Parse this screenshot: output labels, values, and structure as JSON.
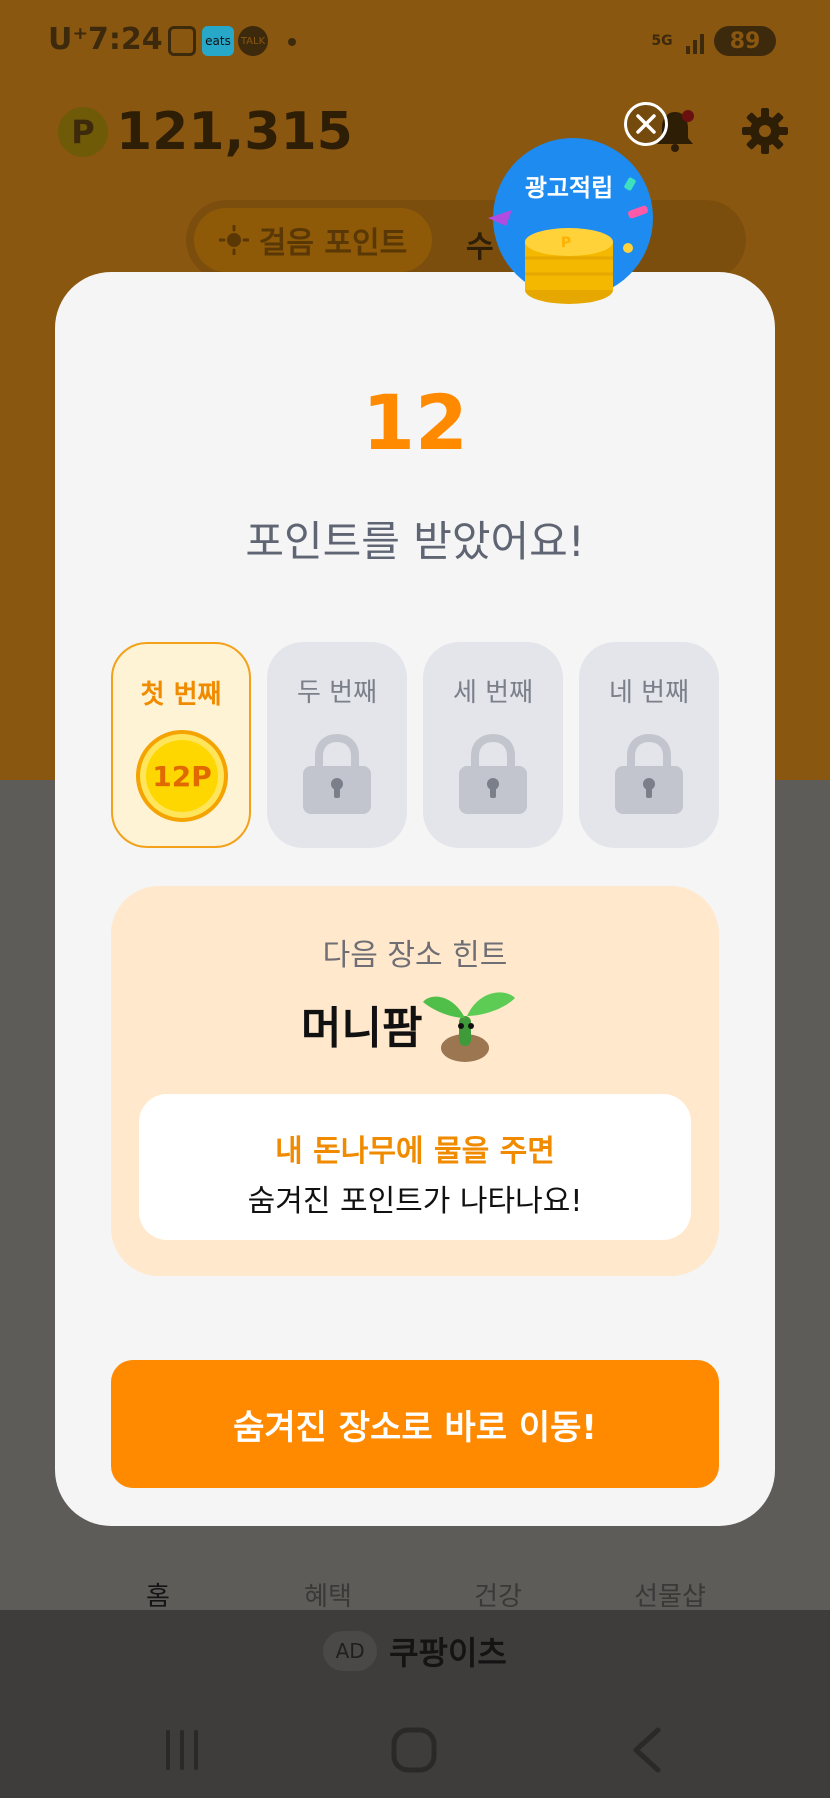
{
  "status_bar": {
    "carrier": "U⁺",
    "time": "7:24",
    "eats_label": "eats",
    "talk_label": "TALK",
    "network": "5G",
    "battery": "89"
  },
  "header": {
    "points": "121,315"
  },
  "segment": {
    "active_label": "걸음 포인트",
    "other_label": "수"
  },
  "modal": {
    "badge_label": "광고적립",
    "count": "12",
    "headline": "포인트를 받았어요!",
    "slots": [
      {
        "label": "첫 번째",
        "reward": "12P",
        "state": "unlocked"
      },
      {
        "label": "두 번째",
        "state": "locked"
      },
      {
        "label": "세 번째",
        "state": "locked"
      },
      {
        "label": "네 번째",
        "state": "locked"
      }
    ],
    "hint": {
      "label": "다음 장소 힌트",
      "place": "머니팜",
      "line1": "내 돈나무에 물을 주면",
      "line2": "숨겨진 포인트가 나타나요!"
    },
    "cta_label": "숨겨진 장소로 바로 이동!"
  },
  "bottom_nav": {
    "items": [
      "홈",
      "혜택",
      "건강",
      "선물샵"
    ]
  },
  "ad": {
    "badge": "AD",
    "text": "쿠팡이츠"
  },
  "colors": {
    "accent": "#ff8a00",
    "hint_bg": "#ffe8cc",
    "slot_locked": "#e4e5ea",
    "badge_blue": "#1e8bf0"
  }
}
